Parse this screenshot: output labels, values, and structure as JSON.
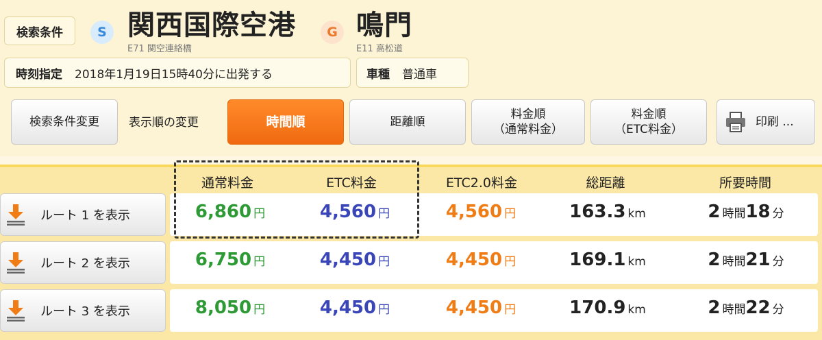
{
  "conditions": {
    "label": "検索条件",
    "from_badge": "S",
    "from_name": "関西国際空港",
    "from_sub": "E71 関空連絡橋",
    "to_badge": "G",
    "to_name": "鳴門",
    "to_sub": "E11 高松道",
    "time_label": "時刻指定",
    "time_value": "2018年1月19日15時40分に出発する",
    "car_label": "車種",
    "car_value": "普通車"
  },
  "toolbar": {
    "change_label": "検索条件変更",
    "sort_label": "表示順の変更",
    "sort_time": "時間順",
    "sort_distance": "距離順",
    "sort_normal_line1": "料金順",
    "sort_normal_line2": "（通常料金）",
    "sort_etc_line1": "料金順",
    "sort_etc_line2": "（ETC料金）",
    "print_label": "印刷 ..."
  },
  "table": {
    "headers": [
      "通常料金",
      "ETC料金",
      "ETC2.0料金",
      "総距離",
      "所要時間"
    ],
    "yen": "円",
    "km": "km",
    "hour_unit": "時間",
    "minute_unit": "分",
    "rows": [
      {
        "button": "ルート 1 を表示",
        "normal": "6,860",
        "etc": "4,560",
        "etc2": "4,560",
        "distance": "163.3",
        "hours": "2",
        "minutes": "18"
      },
      {
        "button": "ルート 2 を表示",
        "normal": "6,750",
        "etc": "4,450",
        "etc2": "4,450",
        "distance": "169.1",
        "hours": "2",
        "minutes": "21"
      },
      {
        "button": "ルート 3 を表示",
        "normal": "8,050",
        "etc": "4,450",
        "etc2": "4,450",
        "distance": "170.9",
        "hours": "2",
        "minutes": "22"
      }
    ]
  },
  "colors": {
    "accent_orange": "#f07c16",
    "normal_fee": "#2e9a36",
    "etc_fee": "#3a46b8"
  }
}
